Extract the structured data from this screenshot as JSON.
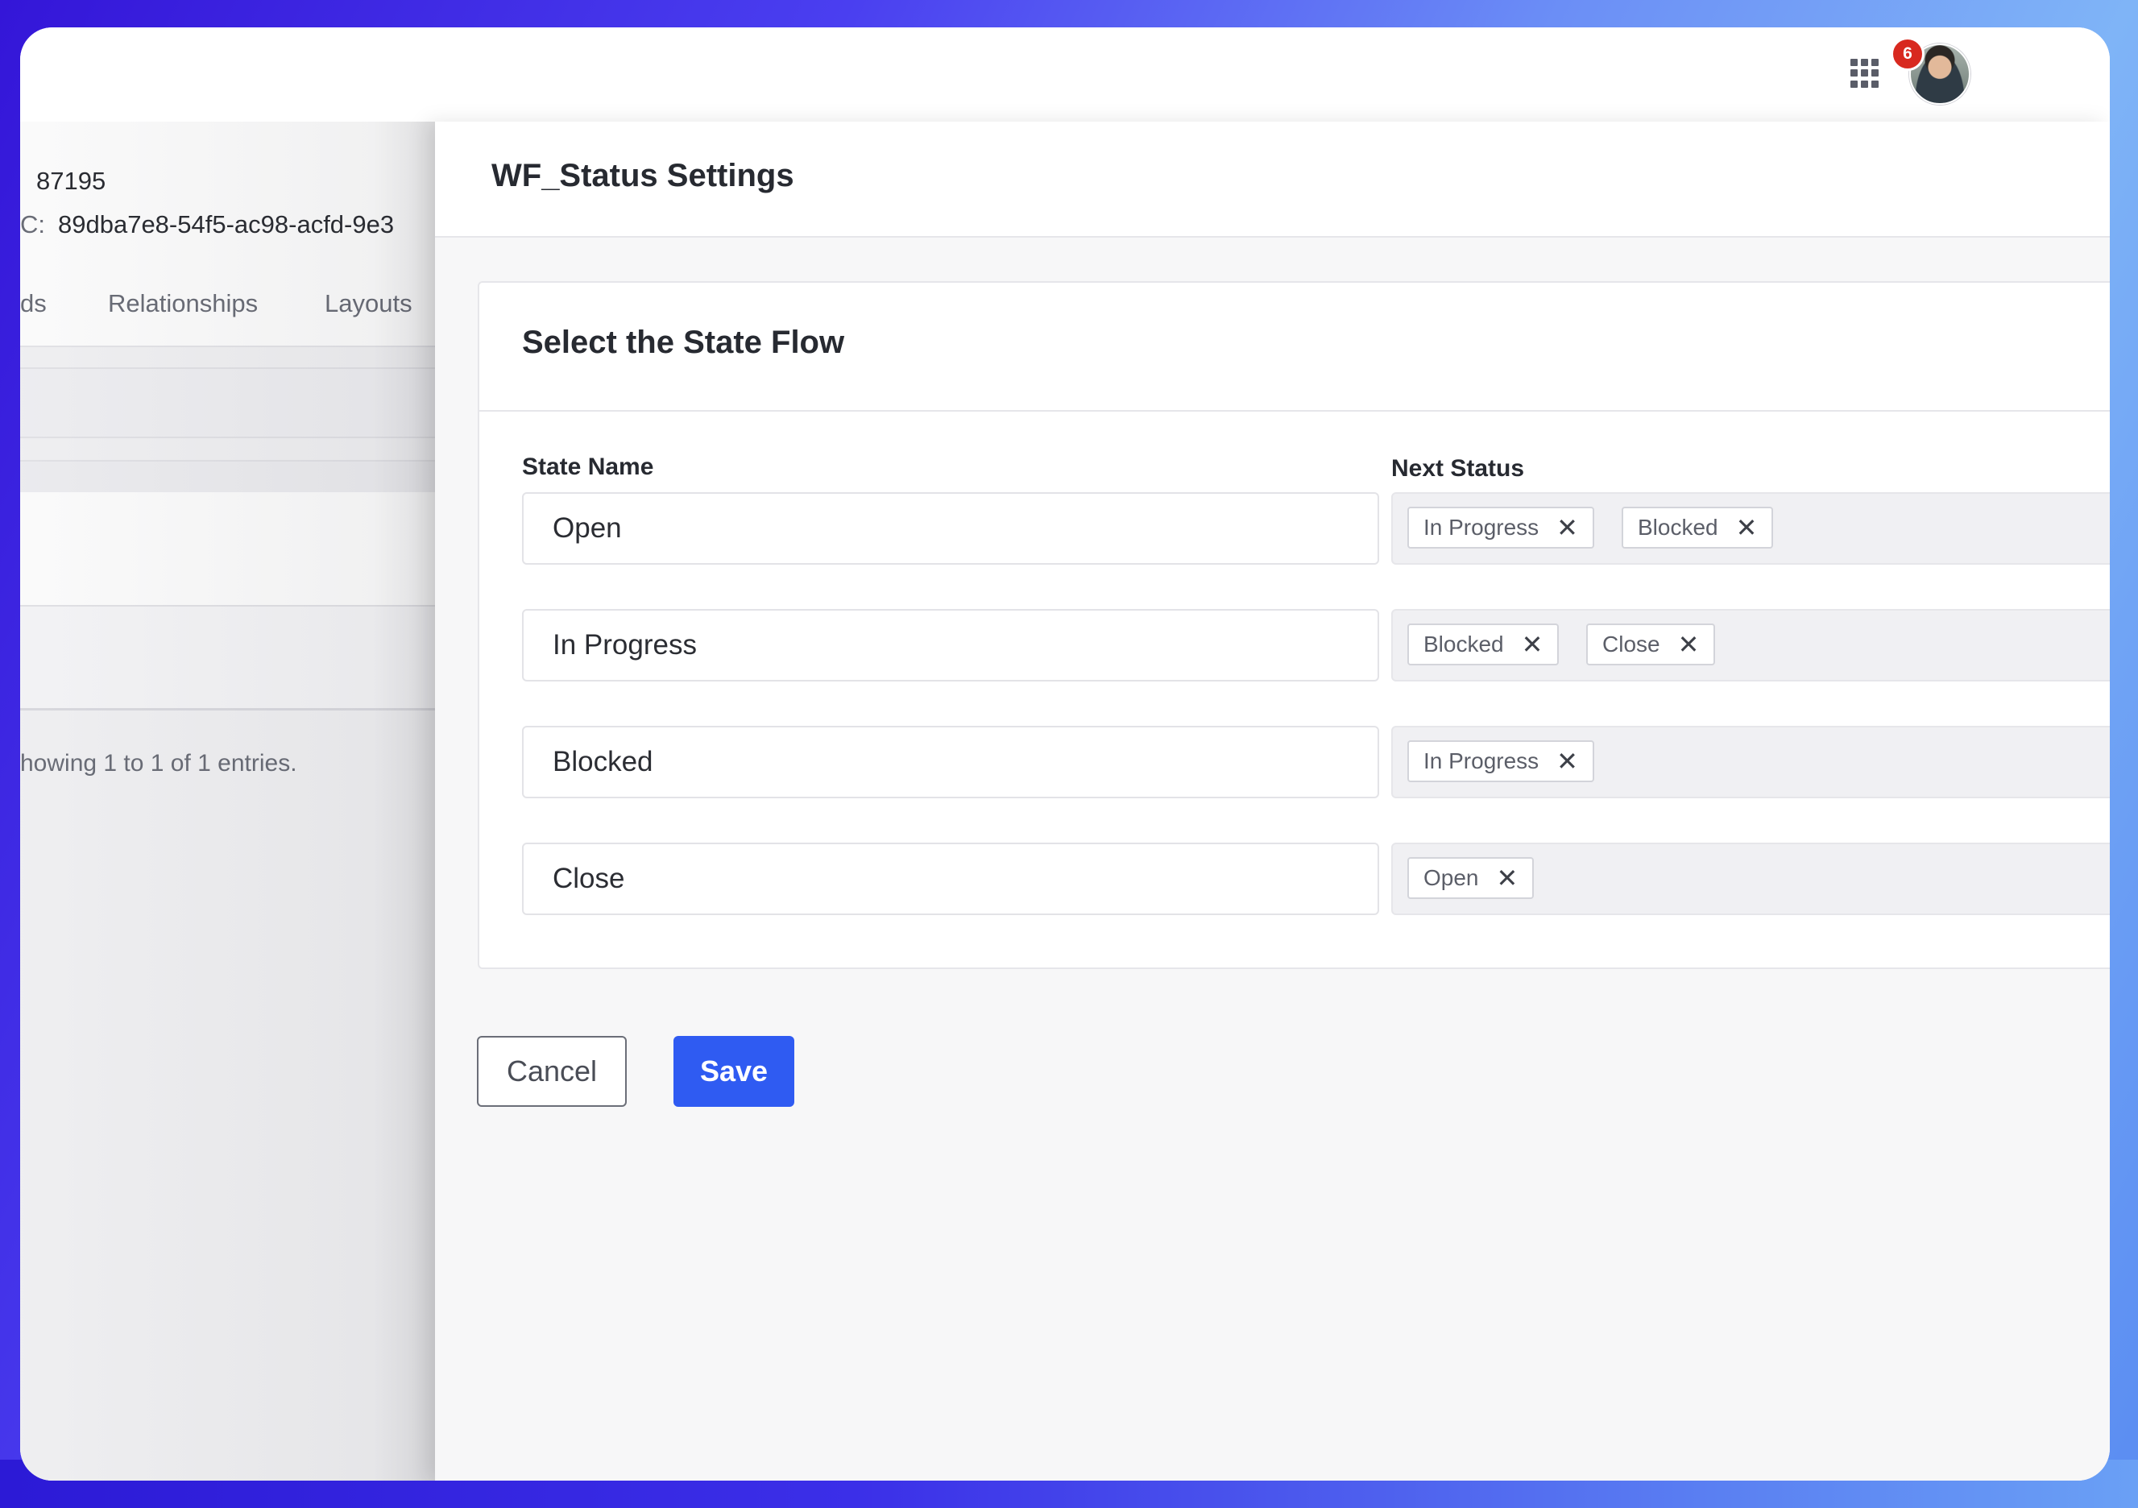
{
  "topbar": {
    "notification_count": "6"
  },
  "left_page": {
    "id_value": "87195",
    "erc_label": "C:",
    "erc_value": "89dba7e8-54f5-ac98-acfd-9e3",
    "tabs": [
      {
        "label": "ds"
      },
      {
        "label": "Relationships"
      },
      {
        "label": "Layouts"
      }
    ],
    "entries_text": "howing 1 to 1 of 1 entries."
  },
  "panel": {
    "title": "WF_Status Settings",
    "card_title": "Select the State Flow",
    "state_name_label": "State Name",
    "next_status_label": "Next Status",
    "rows": [
      {
        "state": "Open",
        "next": [
          "In Progress",
          "Blocked"
        ]
      },
      {
        "state": "In Progress",
        "next": [
          "Blocked",
          "Close"
        ]
      },
      {
        "state": "Blocked",
        "next": [
          "In Progress"
        ]
      },
      {
        "state": "Close",
        "next": [
          "Open"
        ]
      }
    ],
    "remove_symbol": "✕",
    "cancel_label": "Cancel",
    "save_label": "Save"
  },
  "colors": {
    "primary": "#2f5bf2",
    "badge": "#d8291f"
  }
}
